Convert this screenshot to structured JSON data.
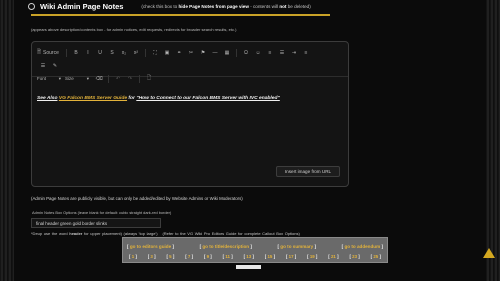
{
  "header": {
    "title": "Wiki Admin Page Notes",
    "note_prefix": "(check this box to ",
    "note_bold1": "hide Page Notes from page view",
    "note_mid": " - contents will ",
    "note_bold2": "not",
    "note_suffix": " be deleted)"
  },
  "helper_text": "(appears above description/contents box - for admin notices, edit requests, redirects for broader search results, etc.)",
  "toolbar": {
    "source_label": "Source",
    "font_label": "Font",
    "size_label": "Size",
    "dropdown_caret": "▾",
    "row1": [
      {
        "name": "bold-button",
        "glyph": "B"
      },
      {
        "name": "italic-button",
        "glyph": "I"
      },
      {
        "name": "underline-button",
        "glyph": "U"
      },
      {
        "name": "strike-button",
        "glyph": "S"
      },
      {
        "name": "subscript-button",
        "glyph": "x₂"
      },
      {
        "name": "superscript-button",
        "glyph": "x²"
      },
      {
        "name": "format-icon",
        "glyph": "⛶"
      },
      {
        "name": "image-icon",
        "glyph": "▣"
      },
      {
        "name": "link-icon",
        "glyph": "⚭"
      },
      {
        "name": "unlink-icon",
        "glyph": "✂"
      },
      {
        "name": "anchor-icon",
        "glyph": "⚑"
      },
      {
        "name": "hr-icon",
        "glyph": "—"
      },
      {
        "name": "table-icon",
        "glyph": "▦"
      },
      {
        "name": "special-char-icon",
        "glyph": "Ω"
      },
      {
        "name": "smiley-icon",
        "glyph": "☺"
      },
      {
        "name": "numbered-list-icon",
        "glyph": "≡"
      },
      {
        "name": "bullet-list-icon",
        "glyph": "☰"
      },
      {
        "name": "indent-icon",
        "glyph": "⇥"
      },
      {
        "name": "align-left-icon",
        "glyph": "≡"
      }
    ],
    "row2_first": [
      {
        "name": "align-justify-icon",
        "glyph": "☰"
      },
      {
        "name": "brush-icon",
        "glyph": "✎"
      }
    ],
    "row3_after": [
      {
        "name": "remove-format-icon",
        "glyph": "⌫",
        "dim": false
      },
      {
        "name": "undo-icon",
        "glyph": "↶",
        "dim": true
      },
      {
        "name": "redo-icon",
        "glyph": "↷",
        "dim": true
      },
      {
        "name": "document-icon",
        "glyph": "🗋",
        "dim": false
      }
    ]
  },
  "editor_content": {
    "see_also": "See Also",
    "link_guide": "VG Falcon BMS Server Guide",
    "for_text": " for ",
    "link_how_to": "\"How to Connect to our Falcon BMS Server with IVC enabled\""
  },
  "insert_image_label": "Insert image from URL",
  "public_note": "(Admin Page Notes are publicly visible, but can only be added/edited by Website Admins or Wiki Moderators)",
  "notes_box_label": "Admin Notes Box Options (leave blank for default: cubic straight dark-red border)",
  "notes_box_value": "final header green gold border slinks",
  "use_line": {
    "prefix": "*Deup use the word ",
    "bold": "header",
    "middle": " for upper placement)  (always 'top large')",
    "suffix": "(Refer to the VG Wiki Pro Editors Guide for complete Callout Box Options)"
  },
  "nav": {
    "links": [
      "go to editors guide",
      "go to title/description",
      "go to summary",
      "go to addendum"
    ],
    "numbers": [
      "1",
      "3",
      "5",
      "7",
      "9",
      "11",
      "13",
      "15",
      "17",
      "19",
      "21",
      "23",
      "25"
    ]
  },
  "colors": {
    "accent_gold": "#e3b33b",
    "hdr_line": "#c9a227",
    "nav_bg": "#6a6a6a",
    "scroll_arrow": "#d4a820"
  },
  "scroll_up_icon": "up-arrow-icon"
}
